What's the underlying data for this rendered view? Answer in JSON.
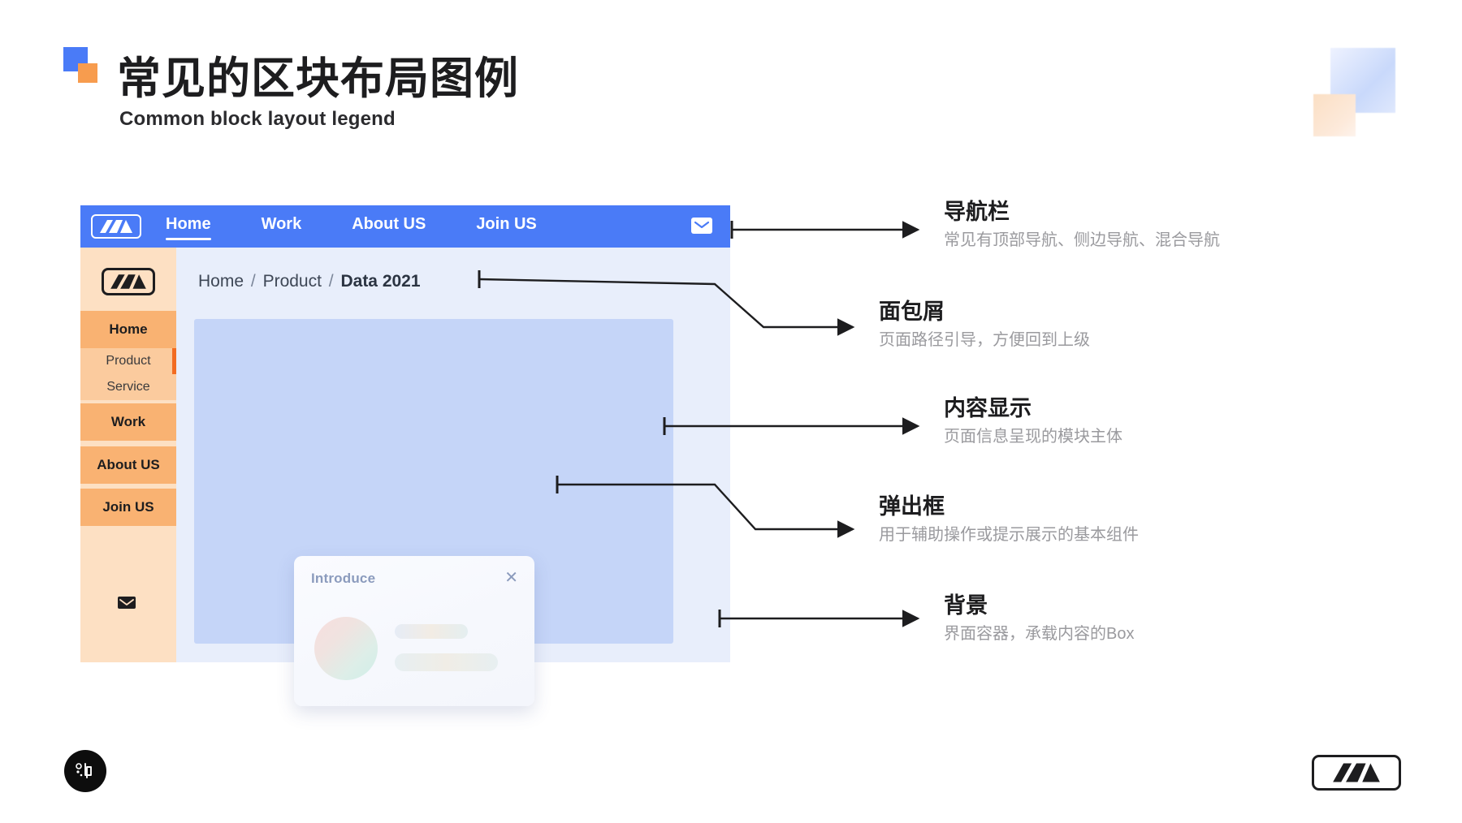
{
  "header": {
    "title_cn": "常见的区块布局图例",
    "title_en": "Common block layout legend"
  },
  "mock": {
    "topnav": {
      "logo_icon": "mountain-logo-icon",
      "items": [
        {
          "label": "Home",
          "active": true
        },
        {
          "label": "Work",
          "active": false
        },
        {
          "label": "About US",
          "active": false
        },
        {
          "label": "Join US",
          "active": false
        }
      ],
      "mail_icon": "mail-icon"
    },
    "sidebar": {
      "logo_icon": "mountain-logo-icon",
      "mail_icon": "mail-icon",
      "items": [
        {
          "label": "Home",
          "type": "primary"
        },
        {
          "label": "Product",
          "type": "sub",
          "current": true
        },
        {
          "label": "Service",
          "type": "sub",
          "current": false
        },
        {
          "label": "Work",
          "type": "primary"
        },
        {
          "label": "About US",
          "type": "primary"
        },
        {
          "label": "Join US",
          "type": "primary"
        }
      ]
    },
    "breadcrumb": {
      "items": [
        "Home",
        "Product",
        "Data 2021"
      ],
      "separator": "/"
    },
    "modal": {
      "title": "Introduce",
      "close_label": "✕"
    }
  },
  "annotations": [
    {
      "title": "导航栏",
      "subtitle": "常见有顶部导航、侧边导航、混合导航"
    },
    {
      "title": "面包屑",
      "subtitle": "页面路径引导，方便回到上级"
    },
    {
      "title": "内容显示",
      "subtitle": "页面信息呈现的模块主体"
    },
    {
      "title": "弹出框",
      "subtitle": "用于辅助操作或提示展示的基本组件"
    },
    {
      "title": "背景",
      "subtitle": "界面容器，承载内容的Box"
    }
  ],
  "colors": {
    "nav_blue": "#4a7bf7",
    "sidebar_orange": "#f9b272",
    "sidebar_light": "#fde0c3",
    "content_blue": "#c5d5f8",
    "accent_orange": "#f26b21"
  }
}
